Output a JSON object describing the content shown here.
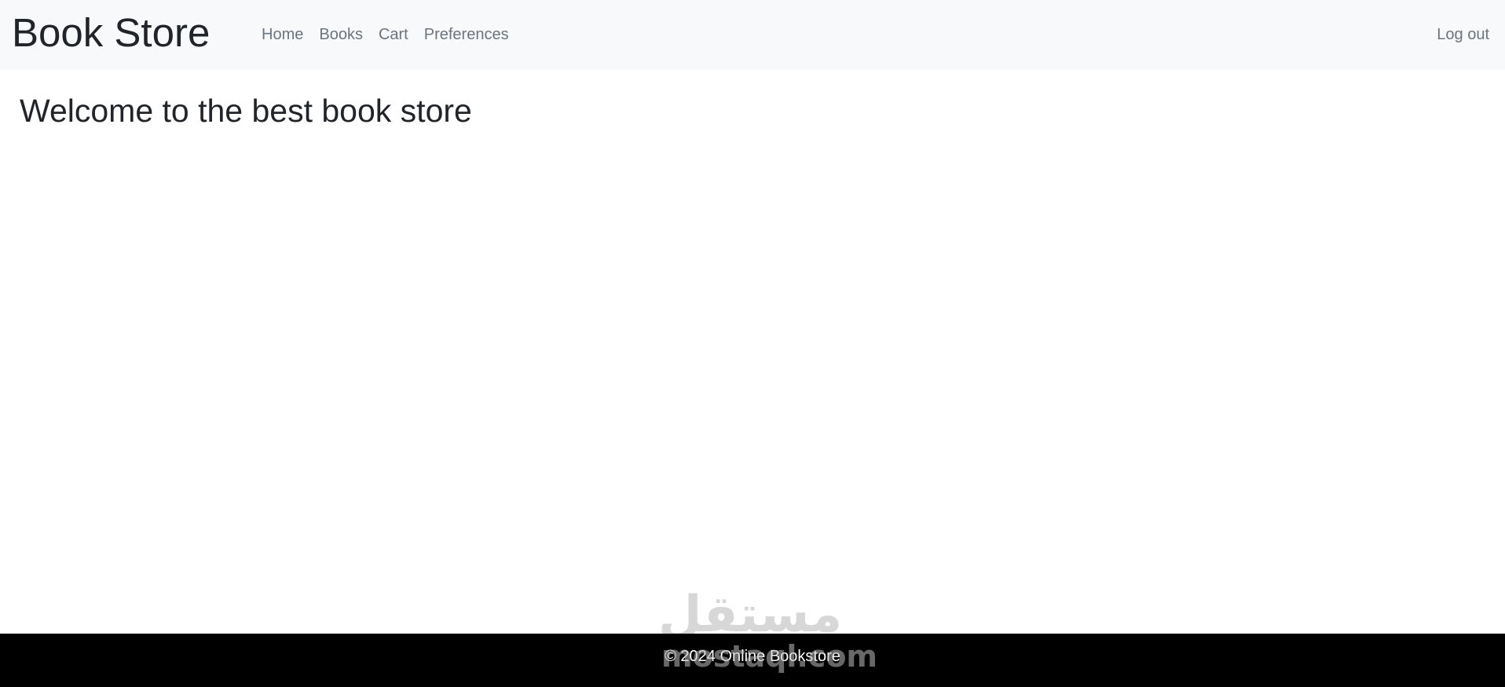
{
  "header": {
    "brand": "Book Store",
    "nav": [
      {
        "label": "Home"
      },
      {
        "label": "Books"
      },
      {
        "label": "Cart"
      },
      {
        "label": "Preferences"
      }
    ],
    "logout_label": "Log out"
  },
  "main": {
    "heading": "Welcome to the best book store"
  },
  "footer": {
    "text": "© 2024 Online Bookstore"
  },
  "watermark": {
    "arabic": "مستقل",
    "latin": "mostaql.com"
  },
  "colors": {
    "navbar_bg": "#f8f9fa",
    "nav_link": "#6c757d",
    "text": "#212529",
    "footer_bg": "#000000",
    "footer_text": "#ffffff"
  }
}
